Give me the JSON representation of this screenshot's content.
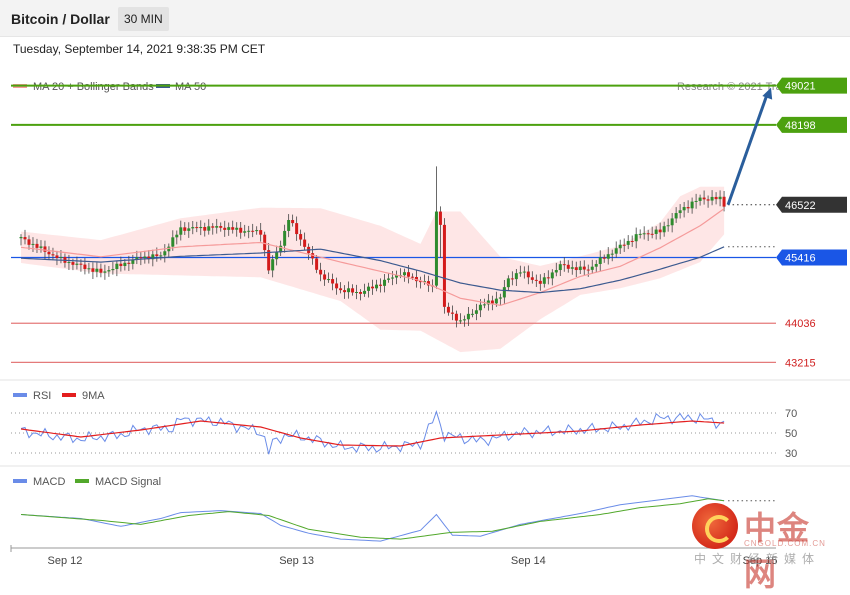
{
  "header": {
    "title": "Bitcoin / Dollar",
    "timeframe": "30 MIN"
  },
  "datetime": "Tuesday, September 14, 2021 9:38:35 PM CET",
  "legend": {
    "bb": "MA 20 + Bollinger Bands",
    "ma50": "MA 50",
    "credit": "Research © 2021 Trading Central"
  },
  "colors": {
    "green": "#4ca10f",
    "red": "#e47a7a",
    "blue": "#1a56e6",
    "dark": "#333333",
    "up": "#2e8b2e",
    "down": "#d41b1b",
    "arrow": "#2a5e9c",
    "band": "#fddddd",
    "ma20": "#f59a9a",
    "ma50": "#3c5a8f",
    "rsi": "#6a8ce8",
    "rsi_ma": "#e31e1e",
    "macd": "#6a8ce8",
    "macd_sig": "#52a82b"
  },
  "chart_data": [
    {
      "type": "candlestick",
      "title": "Bitcoin / Dollar",
      "timeframe": "30 MIN",
      "ylim": [
        42950,
        49350
      ],
      "x_tick_labels": [
        "Sep 12",
        "Sep 13",
        "Sep 14",
        "Sep 15"
      ],
      "levels": [
        {
          "value": 49021,
          "label": "49021",
          "kind": "resistance",
          "color": "#4ca10f"
        },
        {
          "value": 48198,
          "label": "48198",
          "kind": "resistance",
          "color": "#4ca10f"
        },
        {
          "value": 46522,
          "label": "46522",
          "kind": "last",
          "color": "#333333"
        },
        {
          "value": 45416,
          "label": "45416",
          "kind": "pivot",
          "color": "#1a56e6"
        },
        {
          "value": 44036,
          "label": "44036",
          "kind": "support",
          "color": "#e47a7a"
        },
        {
          "value": 43215,
          "label": "43215",
          "kind": "support",
          "color": "#e47a7a"
        }
      ],
      "close_anchors": [
        [
          0,
          45820
        ],
        [
          10,
          45370
        ],
        [
          20,
          45100
        ],
        [
          30,
          45420
        ],
        [
          35,
          45450
        ],
        [
          40,
          46020
        ],
        [
          50,
          46050
        ],
        [
          55,
          45980
        ],
        [
          60,
          45950
        ],
        [
          62,
          45160
        ],
        [
          65,
          45700
        ],
        [
          67,
          46220
        ],
        [
          70,
          45800
        ],
        [
          75,
          45050
        ],
        [
          80,
          44730
        ],
        [
          85,
          44680
        ],
        [
          90,
          44870
        ],
        [
          95,
          45090
        ],
        [
          100,
          44920
        ],
        [
          104,
          44760
        ],
        [
          106,
          46380
        ],
        [
          108,
          44230
        ],
        [
          110,
          44060
        ],
        [
          115,
          44400
        ],
        [
          120,
          44580
        ],
        [
          122,
          44960
        ],
        [
          125,
          45120
        ],
        [
          130,
          44870
        ],
        [
          135,
          45250
        ],
        [
          140,
          45170
        ],
        [
          142,
          45170
        ],
        [
          145,
          45360
        ],
        [
          150,
          45650
        ],
        [
          155,
          45910
        ],
        [
          160,
          45960
        ],
        [
          165,
          46410
        ],
        [
          170,
          46650
        ],
        [
          175,
          46650
        ],
        [
          176,
          46530
        ]
      ],
      "series": [
        {
          "name": "MA 20 + Bollinger Bands",
          "ma": [
            [
              0,
              45630
            ],
            [
              20,
              45430
            ],
            [
              40,
              45640
            ],
            [
              60,
              45730
            ],
            [
              80,
              45320
            ],
            [
              100,
              44930
            ],
            [
              110,
              44560
            ],
            [
              120,
              44410
            ],
            [
              130,
              44680
            ],
            [
              140,
              45020
            ],
            [
              150,
              45230
            ],
            [
              160,
              45620
            ],
            [
              170,
              46080
            ],
            [
              176,
              46440
            ]
          ],
          "upper": [
            [
              0,
              45960
            ],
            [
              20,
              45780
            ],
            [
              40,
              46240
            ],
            [
              60,
              46460
            ],
            [
              75,
              46450
            ],
            [
              90,
              46080
            ],
            [
              100,
              45700
            ],
            [
              104,
              46380
            ],
            [
              110,
              46380
            ],
            [
              120,
              45430
            ],
            [
              130,
              45240
            ],
            [
              140,
              45440
            ],
            [
              150,
              45660
            ],
            [
              160,
              46150
            ],
            [
              165,
              46700
            ],
            [
              170,
              46900
            ],
            [
              176,
              46900
            ]
          ],
          "lower": [
            [
              0,
              45300
            ],
            [
              20,
              45080
            ],
            [
              40,
              45040
            ],
            [
              60,
              45000
            ],
            [
              80,
              44500
            ],
            [
              90,
              43900
            ],
            [
              100,
              43880
            ],
            [
              110,
              43430
            ],
            [
              120,
              43500
            ],
            [
              130,
              44120
            ],
            [
              140,
              44630
            ],
            [
              150,
              44770
            ],
            [
              160,
              44980
            ],
            [
              170,
              45320
            ],
            [
              176,
              45900
            ]
          ]
        },
        {
          "name": "MA 50",
          "values": [
            [
              0,
              45400
            ],
            [
              20,
              45320
            ],
            [
              40,
              45440
            ],
            [
              60,
              45510
            ],
            [
              75,
              45590
            ],
            [
              90,
              45350
            ],
            [
              100,
              45130
            ],
            [
              110,
              44880
            ],
            [
              120,
              44730
            ],
            [
              130,
              44680
            ],
            [
              140,
              44760
            ],
            [
              150,
              44940
            ],
            [
              160,
              45170
            ],
            [
              170,
              45420
            ],
            [
              176,
              45640
            ]
          ]
        }
      ],
      "forecast_arrow": {
        "from": [
          176,
          46522
        ],
        "to": [
          189,
          49021
        ]
      }
    },
    {
      "type": "line",
      "title": "RSI",
      "ylim": [
        25,
        78
      ],
      "y_tick_labels": [
        "70",
        "50",
        "30"
      ],
      "series": [
        {
          "name": "RSI",
          "values": [
            [
              0,
              52
            ],
            [
              8,
              47
            ],
            [
              15,
              44
            ],
            [
              25,
              48
            ],
            [
              30,
              54
            ],
            [
              38,
              55
            ],
            [
              40,
              64
            ],
            [
              50,
              61
            ],
            [
              60,
              51
            ],
            [
              62,
              37
            ],
            [
              66,
              48
            ],
            [
              72,
              45
            ],
            [
              80,
              36
            ],
            [
              90,
              35
            ],
            [
              100,
              39
            ],
            [
              104,
              69
            ],
            [
              106,
              48
            ],
            [
              115,
              42
            ],
            [
              125,
              50
            ],
            [
              140,
              53
            ],
            [
              150,
              56
            ],
            [
              160,
              65
            ],
            [
              170,
              65
            ],
            [
              176,
              59
            ]
          ]
        },
        {
          "name": "9MA",
          "values": [
            [
              0,
              54
            ],
            [
              15,
              46
            ],
            [
              30,
              53
            ],
            [
              45,
              62
            ],
            [
              60,
              56
            ],
            [
              70,
              45
            ],
            [
              80,
              38
            ],
            [
              95,
              37
            ],
            [
              105,
              45
            ],
            [
              120,
              48
            ],
            [
              140,
              52
            ],
            [
              155,
              58
            ],
            [
              168,
              62
            ],
            [
              176,
              60
            ]
          ]
        }
      ]
    },
    {
      "type": "line",
      "title": "MACD",
      "ylim": [
        -3.2,
        3.2
      ],
      "series": [
        {
          "name": "MACD",
          "values": [
            [
              0,
              0.2
            ],
            [
              15,
              -0.2
            ],
            [
              25,
              -1.0
            ],
            [
              35,
              -0.2
            ],
            [
              40,
              0.4
            ],
            [
              50,
              0.6
            ],
            [
              60,
              0.3
            ],
            [
              65,
              -0.9
            ],
            [
              72,
              -1.7
            ],
            [
              80,
              -2.3
            ],
            [
              90,
              -2.5
            ],
            [
              100,
              -1.4
            ],
            [
              104,
              0.2
            ],
            [
              108,
              -1.9
            ],
            [
              115,
              -2.0
            ],
            [
              125,
              -0.8
            ],
            [
              140,
              0.3
            ],
            [
              150,
              1.2
            ],
            [
              160,
              1.7
            ],
            [
              168,
              2.1
            ],
            [
              176,
              1.6
            ]
          ]
        },
        {
          "name": "MACD Signal",
          "values": [
            [
              0,
              0.2
            ],
            [
              20,
              -0.4
            ],
            [
              30,
              -0.8
            ],
            [
              42,
              0.1
            ],
            [
              52,
              0.5
            ],
            [
              62,
              0.1
            ],
            [
              72,
              -1.3
            ],
            [
              85,
              -2.1
            ],
            [
              95,
              -2.3
            ],
            [
              108,
              -1.6
            ],
            [
              118,
              -1.5
            ],
            [
              130,
              -0.5
            ],
            [
              145,
              0.2
            ],
            [
              155,
              0.9
            ],
            [
              165,
              1.3
            ],
            [
              172,
              1.8
            ],
            [
              176,
              1.6
            ]
          ]
        }
      ]
    }
  ],
  "rsi_legend": {
    "a": "RSI",
    "b": "9MA"
  },
  "macd_legend": {
    "a": "MACD",
    "b": "MACD Signal"
  },
  "watermark": {
    "cn": "中金网",
    "en": "CNGOLD.COM.CN",
    "sub": "中文财经新媒体"
  }
}
